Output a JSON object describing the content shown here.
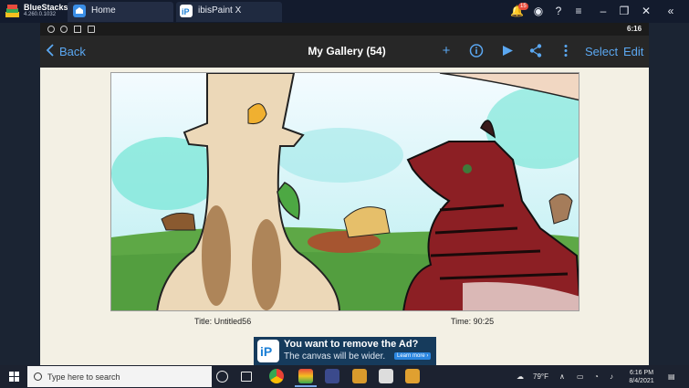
{
  "bluestacks": {
    "name": "BlueStacks",
    "version": "4.260.0.1032",
    "tabs": [
      {
        "label": "Home"
      },
      {
        "label": "ibisPaint X"
      }
    ],
    "notification_count": "15"
  },
  "android_status": {
    "time": "6:16"
  },
  "toolbar": {
    "back_label": "Back",
    "title": "My Gallery (54)",
    "select_label": "Select",
    "edit_label": "Edit"
  },
  "artwork": {
    "title_caption": "Title: Untitled56",
    "time_caption": "Time:  90:25"
  },
  "ad": {
    "headline": "You want to remove the Ad?",
    "subline": "The canvas will be wider.",
    "button_label": "Learn more ›"
  },
  "taskbar": {
    "search_placeholder": "Type here to search",
    "weather": "79°F",
    "time": "6:16 PM",
    "date": "8/4/2021"
  }
}
